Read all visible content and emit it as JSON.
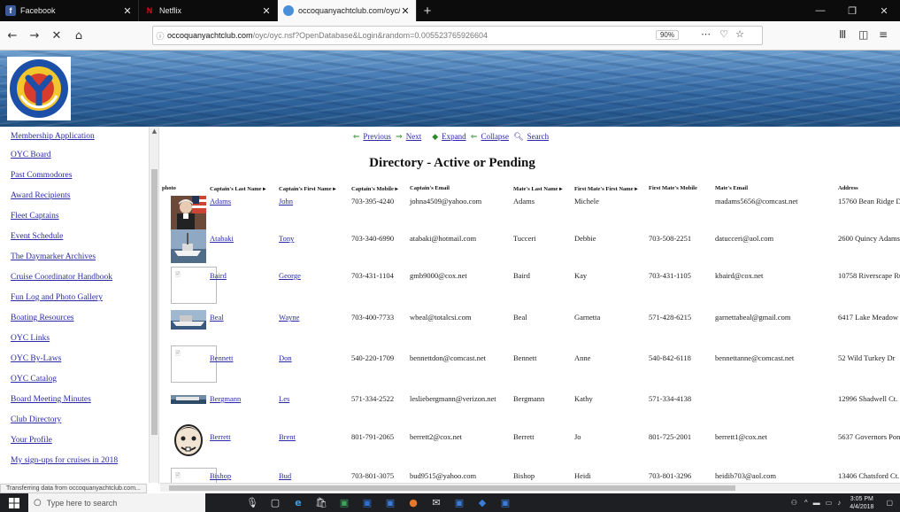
{
  "browser": {
    "tabs": [
      {
        "label": "Facebook",
        "icon": "facebook-icon"
      },
      {
        "label": "Netflix",
        "icon": "netflix-icon"
      },
      {
        "label": "occoquanyachtclub.com/oyc/o",
        "icon": "site-icon"
      }
    ],
    "url_host": "occoquanyachtclub.com",
    "url_rest": "/oyc/oyc.nsf?OpenDatabase&Login&random=0.005523765926604",
    "zoom": "90%",
    "status_text": "Transferring data from occoquanyachtclub.com..."
  },
  "sidebar": {
    "items": [
      "Membership Application",
      "OYC Board",
      "Past Commodores",
      "Award Recipients",
      "Fleet Captains",
      "Event Schedule",
      "The Daymarker Archives",
      "Cruise Coordinator Handbook",
      "Fun Log and Photo Gallery",
      "Boating Resources",
      "OYC Links",
      "OYC By-Laws",
      "OYC Catalog",
      "Board Meeting Minutes",
      "Club Directory",
      "Your Profile",
      "My sign-ups for cruises in 2018"
    ]
  },
  "actions": {
    "previous": "Previous",
    "next": "Next",
    "expand": "Expand",
    "collapse": "Collapse",
    "search": "Search"
  },
  "page": {
    "title": "Directory - Active or Pending"
  },
  "table": {
    "columns": {
      "photo": "photo",
      "cap_last": "Captain's Last Name",
      "cap_first": "Captain's First Name",
      "cap_mobile": "Captain's Mobile",
      "cap_email": "Captain's Email",
      "mate_last": "Mate's Last Name",
      "mate_first": "First Mate's First Name",
      "mate_mobile": "First Mate's Mobile",
      "mate_email": "Mate's Email",
      "address": "Address"
    },
    "rows": [
      {
        "cap_last": "Adams",
        "cap_first": "John",
        "cap_mobile": "703-395-4240",
        "cap_email": "johna4509@yahoo.com",
        "mate_last": "Adams",
        "mate_first": "Michele",
        "mate_mobile": "",
        "mate_email": "madams5656@comcast.net",
        "address": "15760 Bean Ridge D"
      },
      {
        "cap_last": "Atabaki",
        "cap_first": "Tony",
        "cap_mobile": "703-340-6990",
        "cap_email": "atabaki@hotmail.com",
        "mate_last": "Tucceri",
        "mate_first": "Debbie",
        "mate_mobile": "703-508-2251",
        "mate_email": "datucceri@aol.com",
        "address": "2600 Quincy Adams"
      },
      {
        "cap_last": "Baird",
        "cap_first": "George",
        "cap_mobile": "703-431-1104",
        "cap_email": "gmb9000@cox.net",
        "mate_last": "Baird",
        "mate_first": "Kay",
        "mate_mobile": "703-431-1105",
        "mate_email": "kbaird@cox.net",
        "address": "10758 Riverscape Ru"
      },
      {
        "cap_last": "Beal",
        "cap_first": "Wayne",
        "cap_mobile": "703-400-7733",
        "cap_email": "wbeal@totalcsi.com",
        "mate_last": "Beal",
        "mate_first": "Garnetta",
        "mate_mobile": "571-428-6215",
        "mate_email": "garnettabeal@gmail.com",
        "address": "6417 Lake Meadow"
      },
      {
        "cap_last": "Bennett",
        "cap_first": "Don",
        "cap_mobile": "540-220-1709",
        "cap_email": "bennettdon@comcast.net",
        "mate_last": "Bennett",
        "mate_first": "Anne",
        "mate_mobile": "540-842-6118",
        "mate_email": "bennettanne@comcast.net",
        "address": "52 Wild Turkey Dr"
      },
      {
        "cap_last": "Bergmann",
        "cap_first": "Les",
        "cap_mobile": "571-334-2522",
        "cap_email": "lesliebergmann@verizon.net",
        "mate_last": "Bergmann",
        "mate_first": "Kathy",
        "mate_mobile": "571-334-4138",
        "mate_email": "",
        "address": "12996 Shadwell Ct."
      },
      {
        "cap_last": "Berrett",
        "cap_first": "Brent",
        "cap_mobile": "801-791-2065",
        "cap_email": "berrett2@cox.net",
        "mate_last": "Berrett",
        "mate_first": "Jo",
        "mate_mobile": "801-725-2001",
        "mate_email": "berrett1@cox.net",
        "address": "5637 Governors Pon"
      },
      {
        "cap_last": "Bishop",
        "cap_first": "Bud",
        "cap_mobile": "703-801-3075",
        "cap_email": "bud9515@yahoo.com",
        "mate_last": "Bishop",
        "mate_first": "Heidi",
        "mate_mobile": "703-801-3296",
        "mate_email": "heidib703@aol.com",
        "address": "13406 Chatsford Ct."
      }
    ]
  },
  "taskbar": {
    "search_placeholder": "Type here to search",
    "time": "3:05 PM",
    "date": "4/4/2018"
  }
}
